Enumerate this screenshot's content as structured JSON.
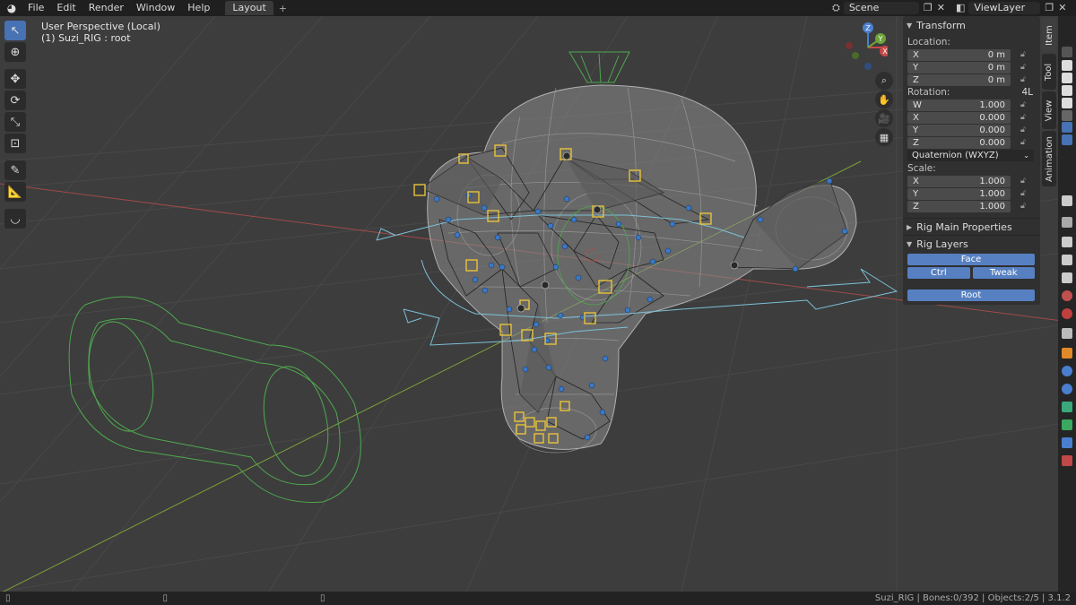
{
  "topbar": {
    "menus": [
      "File",
      "Edit",
      "Render",
      "Window",
      "Help"
    ],
    "workspace_tab": "Layout",
    "add_tab": "+",
    "scene": "Scene",
    "view_layer": "ViewLayer"
  },
  "viewport": {
    "perspective": "User Perspective (Local)",
    "object_info": "(1) Suzi_RIG : root",
    "gizmo_axes": [
      "Z",
      "Y",
      "X"
    ]
  },
  "npanel": {
    "transform_header": "Transform",
    "location_label": "Location:",
    "location": [
      {
        "axis": "X",
        "value": "0 m"
      },
      {
        "axis": "Y",
        "value": "0 m"
      },
      {
        "axis": "Z",
        "value": "0 m"
      }
    ],
    "rotation_label": "Rotation:",
    "rotation_mode_short": "4L",
    "rotation": [
      {
        "axis": "W",
        "value": "1.000"
      },
      {
        "axis": "X",
        "value": "0.000"
      },
      {
        "axis": "Y",
        "value": "0.000"
      },
      {
        "axis": "Z",
        "value": "0.000"
      }
    ],
    "rotation_mode": "Quaternion (WXYZ)",
    "scale_label": "Scale:",
    "scale": [
      {
        "axis": "X",
        "value": "1.000"
      },
      {
        "axis": "Y",
        "value": "1.000"
      },
      {
        "axis": "Z",
        "value": "1.000"
      }
    ],
    "rig_main_header": "Rig Main Properties",
    "rig_layers_header": "Rig Layers",
    "layer_buttons": {
      "face": "Face",
      "ctrl": "Ctrl",
      "tweak": "Tweak",
      "root": "Root"
    }
  },
  "sidebar_tabs": [
    "Item",
    "Tool",
    "View",
    "Animation"
  ],
  "statusbar": {
    "right_text": "Suzi_RIG | Bones:0/392 | Objects:2/5 | 3.1.2"
  },
  "colors": {
    "accent_blue": "#4772b3",
    "bone_yellow": "#e8c23a",
    "bone_blue": "#3a78c8",
    "widget_green": "#4fa84f",
    "widget_cyan": "#7cc0d8",
    "axis_red": "#b04545",
    "axis_green": "#6a9a2a"
  }
}
